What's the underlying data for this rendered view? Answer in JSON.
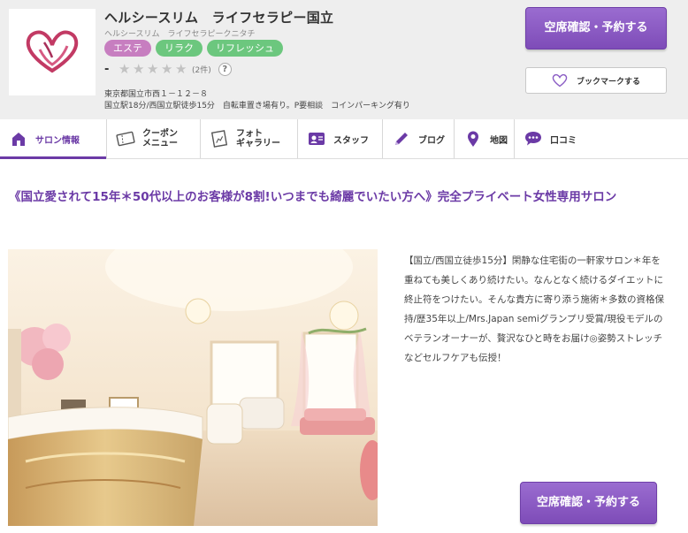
{
  "shop": {
    "name": "ヘルシースリム　ライフセラピー国立",
    "kana": "ヘルシースリム　ライフセラピークニタチ",
    "tags": [
      {
        "label": "エステ",
        "color": "#c77ec0"
      },
      {
        "label": "リラク",
        "color": "#6cc77e"
      },
      {
        "label": "リフレッシュ",
        "color": "#6cc77e"
      }
    ],
    "rating_score": "-",
    "rating_stars": 0,
    "review_count": "(2件)",
    "help_icon": "?",
    "address": "東京都国立市西１－１２－８",
    "access": "国立駅18分/西国立駅徒歩15分　自転車置き場有り。P要相談　コインパーキング有り"
  },
  "actions": {
    "reserve_label": "空席確認・予約する",
    "bookmark_label": "ブックマークする"
  },
  "nav": {
    "items": [
      {
        "label": "サロン情報",
        "icon": "home-icon",
        "active": true
      },
      {
        "label": "クーポン\nメニュー",
        "icon": "coupon-icon",
        "active": false
      },
      {
        "label": "フォト\nギャラリー",
        "icon": "photo-icon",
        "active": false
      },
      {
        "label": "スタッフ",
        "icon": "staff-icon",
        "active": false
      },
      {
        "label": "ブログ",
        "icon": "pen-icon",
        "active": false
      },
      {
        "label": "地図",
        "icon": "map-pin-icon",
        "active": false
      },
      {
        "label": "口コミ",
        "icon": "speech-bubble-icon",
        "active": false
      }
    ]
  },
  "content": {
    "catch_copy": "《国立愛されて15年＊50代以上のお客様が8割!いつまでも綺麗でいたい方へ》完全プライベート女性専用サロン",
    "description": "【国立/西国立徒歩15分】閑静な住宅街の一軒家サロン＊年を重ねても美しくあり続けたい。なんとなく続けるダイエットに終止符をつけたい。そんな貴方に寄り添う施術＊多数の資格保持/歴35年以上/Mrs.Japan semiグランプリ受賞/現役モデルのベテランオーナーが、贅沢なひと時をお届け◎姿勢ストレッチなどセルフケアも伝授！",
    "photo_alt": "サロン内観"
  },
  "colors": {
    "brand_purple": "#6b3aa6",
    "button_purple": "#8a5cc4",
    "header_bg": "#eeeeee"
  }
}
